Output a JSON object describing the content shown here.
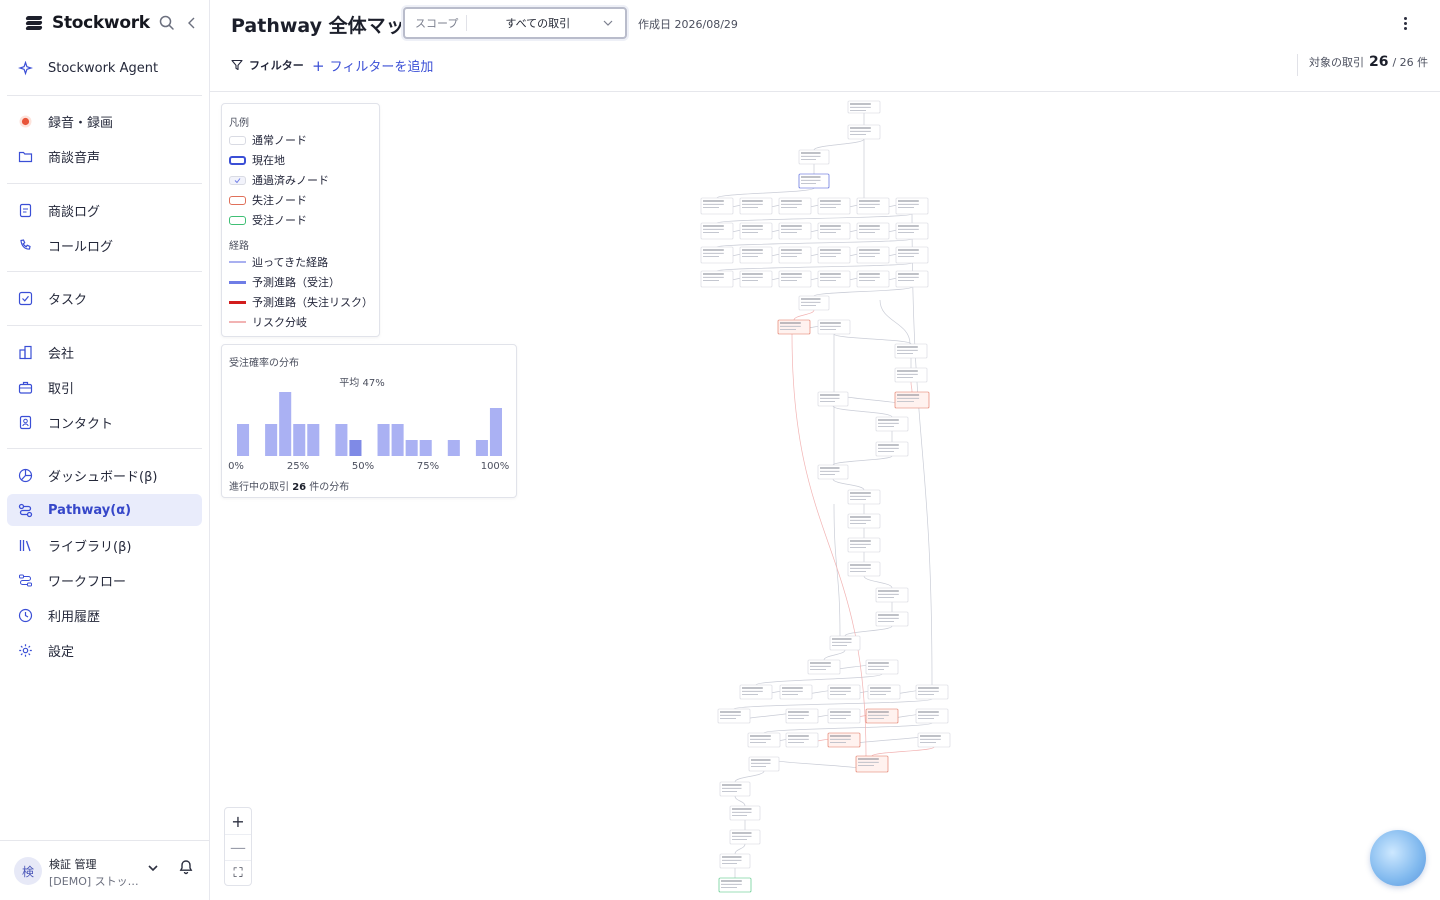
{
  "brand": {
    "name": "Stockwork"
  },
  "sidebar": {
    "items": [
      {
        "key": "agent",
        "label": "Stockwork Agent",
        "icon": "sparkle-icon"
      },
      {
        "key": "record",
        "label": "録音・録画",
        "icon": "record-dot-icon"
      },
      {
        "key": "audio",
        "label": "商談音声",
        "icon": "folder-icon"
      },
      {
        "key": "meeting-log",
        "label": "商談ログ",
        "icon": "document-icon"
      },
      {
        "key": "call-log",
        "label": "コールログ",
        "icon": "phone-icon"
      },
      {
        "key": "task",
        "label": "タスク",
        "icon": "checkbox-icon"
      },
      {
        "key": "company",
        "label": "会社",
        "icon": "building-icon"
      },
      {
        "key": "deal",
        "label": "取引",
        "icon": "briefcase-icon"
      },
      {
        "key": "contact",
        "label": "コンタクト",
        "icon": "contact-card-icon"
      },
      {
        "key": "dashboard",
        "label": "ダッシュボード(β)",
        "icon": "pie-chart-icon"
      },
      {
        "key": "pathway",
        "label": "Pathway(α)",
        "icon": "pathway-icon"
      },
      {
        "key": "library",
        "label": "ライブラリ(β)",
        "icon": "library-icon"
      },
      {
        "key": "workflow",
        "label": "ワークフロー",
        "icon": "workflow-icon"
      },
      {
        "key": "history",
        "label": "利用履歴",
        "icon": "clock-icon"
      },
      {
        "key": "settings",
        "label": "設定",
        "icon": "gear-icon"
      }
    ],
    "active": "pathway"
  },
  "user": {
    "avatar": "検",
    "name": "検証 管理",
    "org": "[DEMO] ストックワーク"
  },
  "header": {
    "title": "Pathway 全体マップ",
    "scope_key": "スコープ",
    "scope_value": "すべての取引",
    "created": "作成日 2026/08/29"
  },
  "filters": {
    "filter_label": "フィルター",
    "add_label": "フィルターを追加",
    "count_label": "対象の取引",
    "count_value": "26",
    "count_total": "/ 26 件"
  },
  "legend": {
    "title": "凡例",
    "nodes": [
      {
        "label": "通常ノード",
        "border": "#d9dbe3",
        "fill": "#ffffff"
      },
      {
        "label": "現在地",
        "border": "#3b4fd6",
        "fill": "#ffffff"
      },
      {
        "label": "通過済みノード",
        "border": "#d9dbe3",
        "fill": "#f2f3fb"
      },
      {
        "label": "失注ノード",
        "border": "#e0705a",
        "fill": "#ffffff"
      },
      {
        "label": "受注ノード",
        "border": "#3fbf75",
        "fill": "#ffffff"
      }
    ],
    "path_title": "経路",
    "paths": [
      {
        "label": "辿ってきた経路",
        "color": "#a9b0f0"
      },
      {
        "label": "予測進路（受注）",
        "color": "#6f7de6"
      },
      {
        "label": "予測進路（失注リスク）",
        "color": "#d21d1d"
      },
      {
        "label": "リスク分岐",
        "color": "#f2b3b3"
      }
    ]
  },
  "distribution": {
    "title": "受注確率の分布",
    "avg": "平均 47%",
    "ticks": [
      "0%",
      "25%",
      "50%",
      "75%",
      "100%"
    ],
    "footer_prefix": "進行中の取引",
    "footer_count": "26",
    "footer_suffix": "件の分布",
    "color": "#aab1f3",
    "highlight_color": "#7f8ae6",
    "chart_data": {
      "type": "bar",
      "bins_percent": [
        0,
        5,
        10,
        15,
        20,
        25,
        30,
        35,
        40,
        45,
        50,
        55,
        60,
        65,
        70,
        75,
        80,
        85,
        90,
        95,
        100
      ],
      "values": [
        2,
        0,
        2,
        4,
        2,
        2,
        0,
        2,
        1,
        0,
        2,
        2,
        1,
        1,
        0,
        1,
        0,
        1,
        3
      ],
      "highlight_bin_index": 8,
      "xlabel": "",
      "ylabel": ""
    }
  },
  "zoom": {
    "in": "+",
    "out": "—",
    "fit": "⛶"
  }
}
